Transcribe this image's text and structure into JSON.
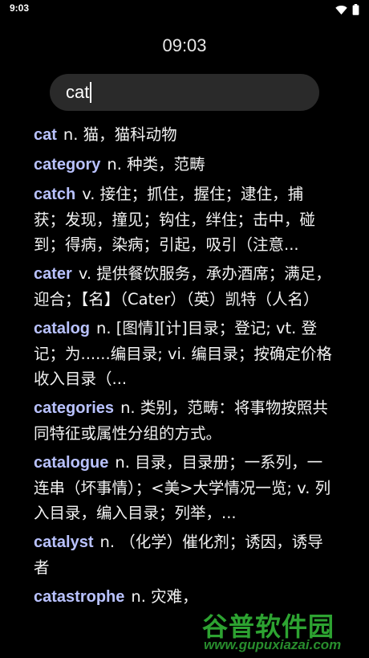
{
  "status_bar": {
    "time": "9:03",
    "icons": [
      "wifi-icon",
      "battery-icon"
    ]
  },
  "clock": "09:03",
  "search": {
    "value": "cat"
  },
  "results": [
    {
      "word": "cat",
      "definition": "n. 猫，猫科动物"
    },
    {
      "word": "category",
      "definition": "n. 种类，范畴"
    },
    {
      "word": "catch",
      "definition": "v. 接住；抓住，握住；逮住，捕获；发现，撞见；钩住，绊住；击中，碰到；得病，染病；引起，吸引（注意..."
    },
    {
      "word": "cater",
      "definition": "v. 提供餐饮服务，承办酒席；满足，迎合；【名】（Cater）（英）凯特（人名）"
    },
    {
      "word": "catalog",
      "definition": "n. [图情][计]目录；登记; vt. 登记；为......编目录; vi. 编目录；按确定价格收入目录（..."
    },
    {
      "word": "categories",
      "definition": "n. 类别，范畴：将事物按照共同特征或属性分组的方式。"
    },
    {
      "word": "catalogue",
      "definition": "n. 目录，目录册；一系列，一连串（坏事情）；<美>大学情况一览; v. 列入目录，编入目录；列举，..."
    },
    {
      "word": "catalyst",
      "definition": "n. （化学）催化剂；诱因，诱导者"
    },
    {
      "word": "catastrophe",
      "definition": "n. 灾难，"
    }
  ],
  "watermark": {
    "title": "谷普软件园",
    "url": "www.gupuxiazai.com"
  },
  "colors": {
    "background": "#000000",
    "word": "#b9c2ff",
    "search_bg": "#2a2a2a",
    "watermark": "#35c03a"
  }
}
